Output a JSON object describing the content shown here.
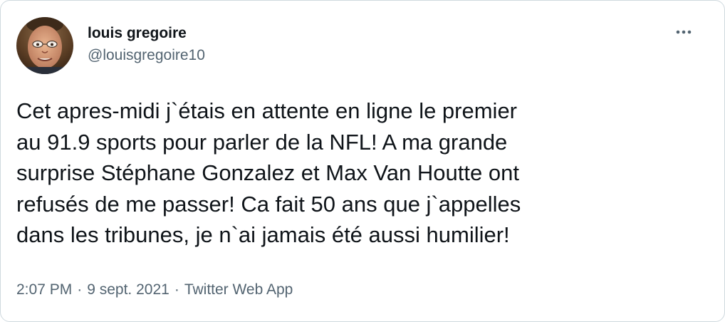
{
  "user": {
    "display_name": "louis gregoire",
    "handle": "@louisgregoire10"
  },
  "actions": {
    "more_icon": "more-horizontal-icon"
  },
  "tweet": {
    "text": "Cet apres-midi j`étais en attente en ligne le premier\nau 91.9  sports pour parler de la NFL! A ma grande\nsurprise Stéphane Gonzalez et Max Van Houtte ont\nrefusés de me passer! Ca fait 50 ans que j`appelles\ndans les tribunes, je n`ai jamais été aussi humilier!"
  },
  "meta": {
    "time": "2:07 PM",
    "separator": "·",
    "date": "9 sept. 2021",
    "source": "Twitter Web App"
  },
  "colors": {
    "text_primary": "#0f1419",
    "text_secondary": "#536471",
    "border": "#cfd9de"
  }
}
